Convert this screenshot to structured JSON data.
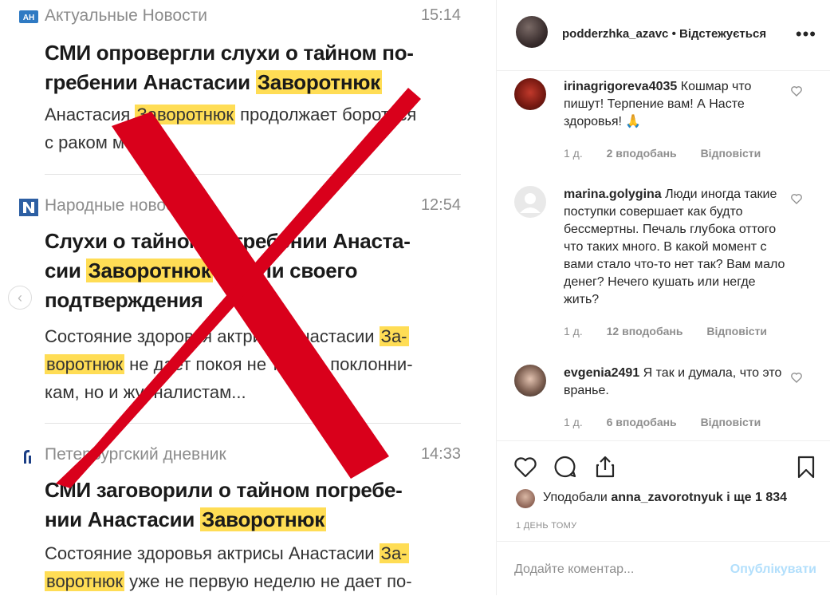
{
  "image": {
    "articles": [
      {
        "source": "Актуальные Новости",
        "time": "15:14",
        "headline_lines": [
          "СМИ опровергли слухи о тайном по-",
          "гребении Анастасии ",
          "Заворотнюк"
        ],
        "snippet_parts": [
          "Анастасия ",
          "Заворотнюк",
          " продолжает бороться",
          "с раком мозга."
        ]
      },
      {
        "source": "Народные новости",
        "time": "12:54",
        "headline_lines": [
          "Слухи о тайном погребении Анаста-",
          "сии ",
          "Заворотнюк",
          " нашли своего",
          "подтверждения"
        ],
        "snippet_parts": [
          "Состояние здоровья актрисы Анастасии ",
          "За-",
          "воротнюк",
          " не дает покоя не только поклонни-",
          "кам, но и журналистам..."
        ]
      },
      {
        "source": "Петербургский дневник",
        "time": "14:33",
        "headline_lines": [
          "СМИ заговорили о тайном погребе-",
          "нии Анастасии ",
          "Заворотнюк"
        ],
        "snippet_parts": [
          "Состояние здоровья актрисы Анастасии ",
          "За-",
          "воротнюк",
          " уже не первую неделю не дает по-"
        ]
      }
    ],
    "prev_symbol": "‹",
    "overlay_color": "#d9001b",
    "highlight_color": "#ffdd55"
  },
  "post": {
    "username": "podderzhka_azavc",
    "separator": "•",
    "follow_status": "Відстежується",
    "more_symbol": "•••"
  },
  "comments": [
    {
      "user": "irinagrigoreva4035",
      "text": "Кошмар что пишут! Терпение вам! А Насте здоровья! 🙏",
      "age": "1 д.",
      "likes": "2 вподобань",
      "reply": "Відповісти"
    },
    {
      "user": "marina.golygina",
      "text": "Люди иногда такие поступки совершает как будто бессмертны. Печаль глубока оттого что таких много. В какой момент с вами стало что-то нет так? Вам мало денег? Нечего кушать или негде жить?",
      "age": "1 д.",
      "likes": "12 вподобань",
      "reply": "Відповісти"
    },
    {
      "user": "evgenia2491",
      "text": "Я так и думала, что это вранье.",
      "age": "1 д.",
      "likes": "6 вподобань",
      "reply": "Відповісти"
    }
  ],
  "actions": {
    "icons": [
      "heart-icon",
      "comment-icon",
      "share-icon",
      "bookmark-icon"
    ],
    "liked_by_prefix": "Уподобали",
    "liked_by_user": "anna_zavorotnyuk",
    "liked_by_suffix": "і ще 1 834",
    "time_ago": "1 ДЕНЬ ТОМУ",
    "comment_placeholder": "Додайте коментар...",
    "publish_label": "Опублікувати"
  }
}
